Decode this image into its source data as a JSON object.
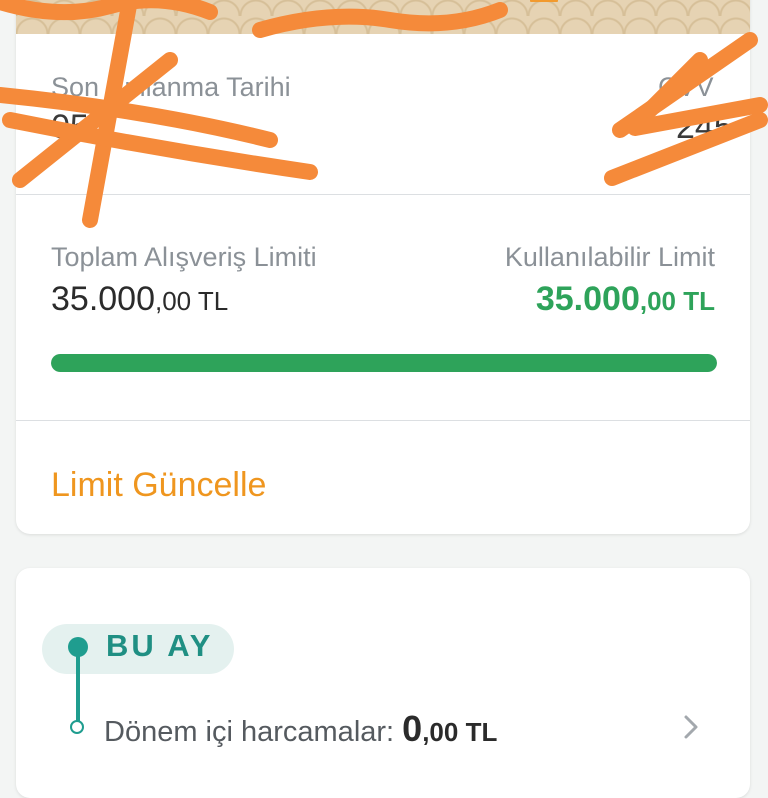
{
  "card": {
    "expiry_label": "Son Kullanma Tarihi",
    "cvv_label": "CVV",
    "total_limit_label": "Toplam Alışveriş Limiti",
    "total_limit_main": "35.000",
    "total_limit_decimals": ",00 TL",
    "available_limit_label": "Kullanılabilir Limit",
    "available_limit_main": "35.000",
    "available_limit_decimals": ",00 TL",
    "available_ratio": 1.0,
    "update_limit_link": "Limit Güncelle"
  },
  "this_month": {
    "badge": "BU AY",
    "period_spending_label": "Dönem içi harcamalar:",
    "period_spending_main": "0",
    "period_spending_decimals": ",00 TL"
  },
  "colors": {
    "accent_green": "#2ea35a",
    "teal": "#1f9d8f",
    "link_orange": "#ef961f",
    "redaction_orange": "#f58a3a"
  },
  "icons": {
    "row_arrow": "chevron-right-icon"
  }
}
